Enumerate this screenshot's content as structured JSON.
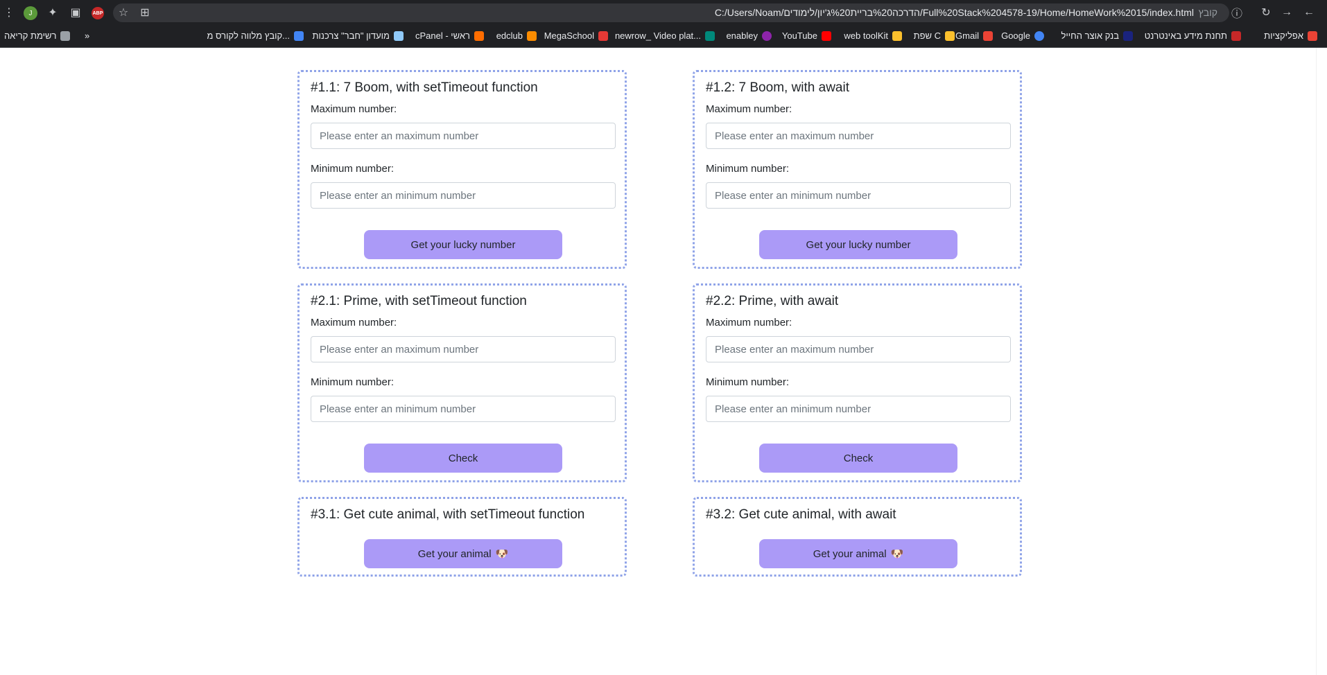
{
  "browser": {
    "url": "C:/Users/Noam/הדרכה%20בריית%20ג'יון/לימודים/Full%20Stack%204578-19/Home/HomeWork%2015/index.html",
    "url_label": "קובץ",
    "profile_initial": "J",
    "abp_label": "ABP"
  },
  "bookmarks": [
    {
      "label": "אפליקציות",
      "color": "#ea4335"
    },
    {
      "label": "תחנת מידע באינטרנט",
      "color": "#c62828"
    },
    {
      "label": "בנק אוצר החייל",
      "color": "#1a237e"
    },
    {
      "label": "Google",
      "color": "#4285f4"
    },
    {
      "label": "Gmail",
      "color": "#ea4335"
    },
    {
      "label": "שפת C",
      "color": "#fbc02d"
    },
    {
      "label": "web toolKit",
      "color": "#fbc02d"
    },
    {
      "label": "YouTube",
      "color": "#ff0000"
    },
    {
      "label": "enabley",
      "color": "#8e24aa"
    },
    {
      "label": "newrow_ Video plat...",
      "color": "#00897b"
    },
    {
      "label": "MegaSchool",
      "color": "#e53935"
    },
    {
      "label": "edclub",
      "color": "#fb8c00"
    },
    {
      "label": "cPanel - ראשי",
      "color": "#ff6d00"
    },
    {
      "label": "מועדון \"חבר\" צרכנות",
      "color": "#90caf9"
    },
    {
      "label": "קובץ מלווה לקורס מ...",
      "color": "#4285f4"
    },
    {
      "label": "רשימת קריאה",
      "color": "#9aa0a6"
    }
  ],
  "cards": {
    "c11": {
      "title": "#1.1: 7 Boom, with setTimeout function",
      "max_label": "Maximum number:",
      "max_placeholder": "Please enter an maximum number",
      "min_label": "Minimum number:",
      "min_placeholder": "Please enter an minimum number",
      "button": "Get your lucky number"
    },
    "c12": {
      "title": "#1.2: 7 Boom, with await",
      "max_label": "Maximum number:",
      "max_placeholder": "Please enter an maximum number",
      "min_label": "Minimum number:",
      "min_placeholder": "Please enter an minimum number",
      "button": "Get your lucky number"
    },
    "c21": {
      "title": "#2.1: Prime, with setTimeout function",
      "max_label": "Maximum number:",
      "max_placeholder": "Please enter an maximum number",
      "min_label": "Minimum number:",
      "min_placeholder": "Please enter an minimum number",
      "button": "Check"
    },
    "c22": {
      "title": "#2.2: Prime, with await",
      "max_label": "Maximum number:",
      "max_placeholder": "Please enter an maximum number",
      "min_label": "Minimum number:",
      "min_placeholder": "Please enter an minimum number",
      "button": "Check"
    },
    "c31": {
      "title": "#3.1: Get cute animal, with setTimeout function",
      "button": "Get your animal",
      "button_emoji": "🐶"
    },
    "c32": {
      "title": "#3.2: Get cute animal, with await",
      "button": "Get your animal",
      "button_emoji": "🐶"
    }
  },
  "colors": {
    "card_border": "#8fa3e8",
    "button_bg": "#ab9af7"
  }
}
